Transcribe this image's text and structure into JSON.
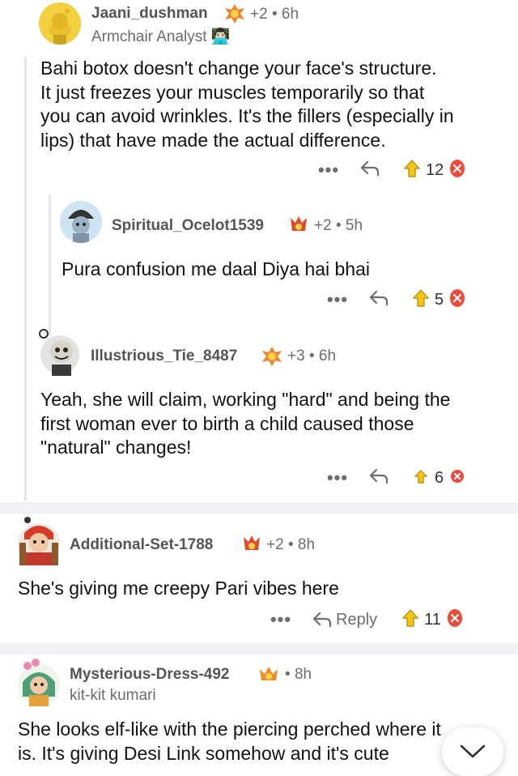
{
  "comments": [
    {
      "username": "Jaani_dushman",
      "awards": "+2",
      "time": "6h",
      "flair": "Armchair Analyst 👨🏻‍💻",
      "lines": [
        "Bahi botox doesn't change your face's structure.",
        "It just freezes your muscles temporarily so that",
        "you can avoid wrinkles. It's the fillers (especially in",
        "lips) that have made the actual difference."
      ],
      "votes": "12"
    },
    {
      "username": "Spiritual_Ocelot1539",
      "awards": "+2",
      "time": "5h",
      "lines": [
        "Pura confusion me daal Diya hai bhai"
      ],
      "votes": "5"
    },
    {
      "username": "Illustrious_Tie_8487",
      "awards": "+3",
      "time": "6h",
      "lines": [
        "Yeah, she will claim, working \"hard\" and being the",
        "first woman ever to birth a child caused those",
        "\"natural\" changes!"
      ],
      "votes": "6"
    },
    {
      "username": "Additional-Set-1788",
      "awards": "+2",
      "time": "8h",
      "lines": [
        "She's giving me creepy Pari vibes here"
      ],
      "votes": "11",
      "reply_label": "Reply"
    },
    {
      "username": "Mysterious-Dress-492",
      "time": "8h",
      "flair": "kit-kit kumari",
      "lines": [
        "She looks elf-like with the piercing perched where it",
        "is. It's giving Desi Link somehow and it's cute"
      ],
      "votes": ""
    }
  ],
  "sep": "•",
  "more_label": "•••",
  "colors": {
    "upvote": "#f5c518",
    "downvote": "#ea4b3b",
    "divider": "#f1f1f3"
  }
}
